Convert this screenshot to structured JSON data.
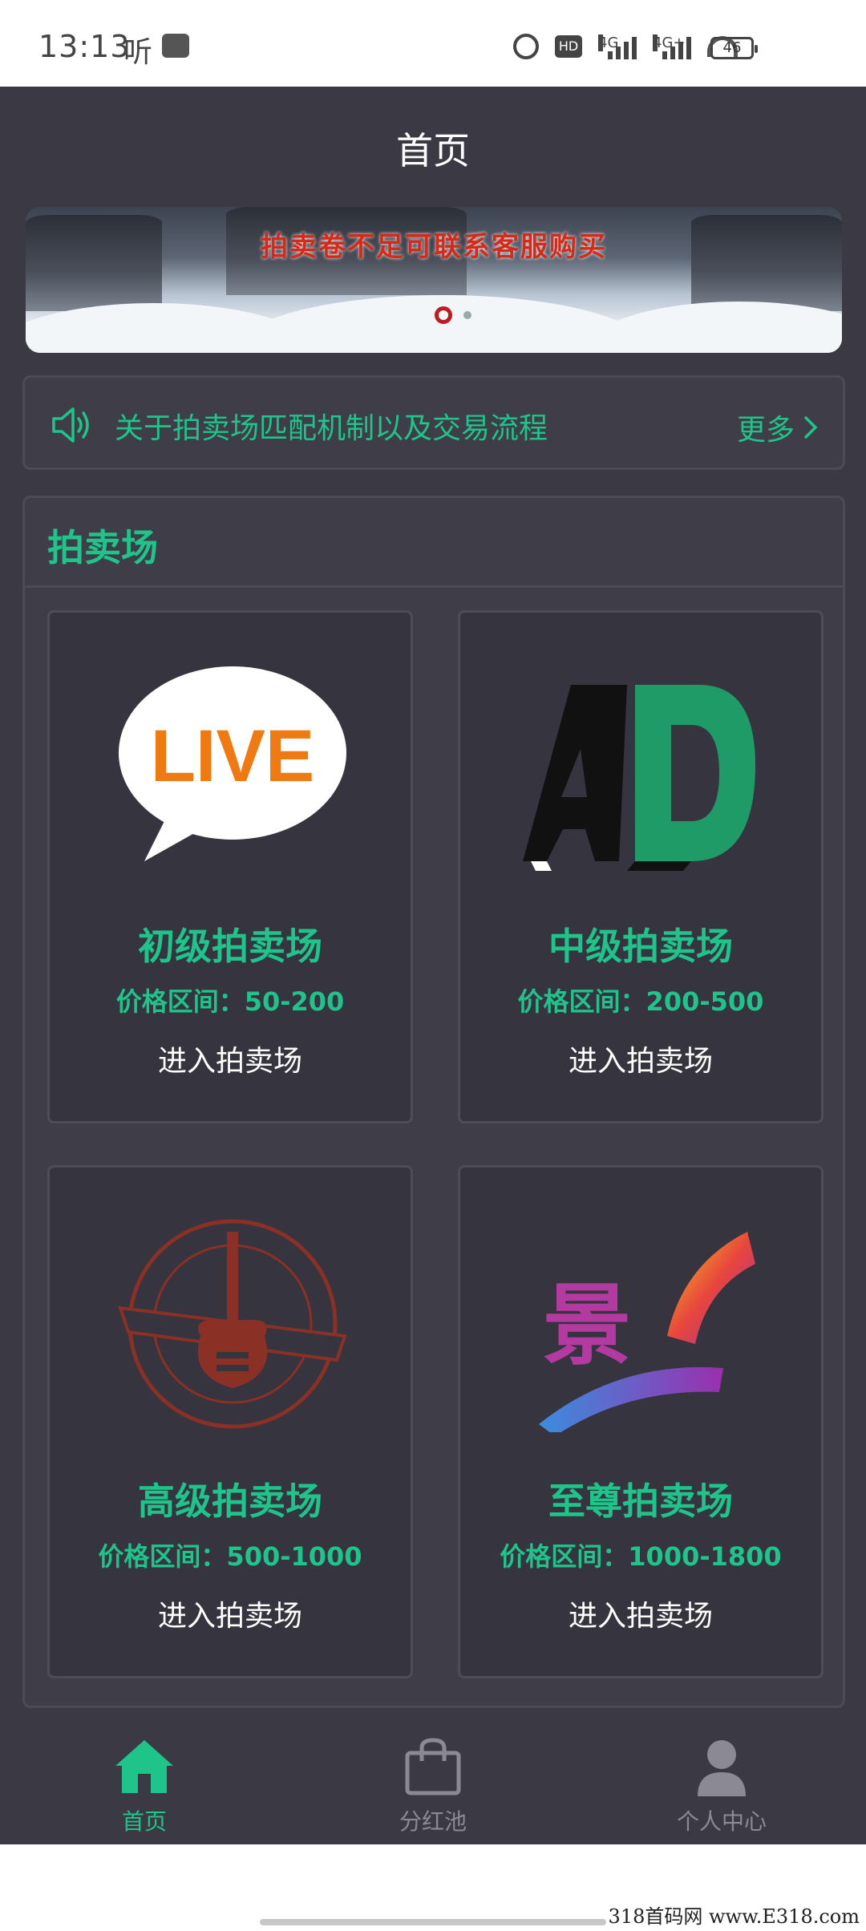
{
  "status_bar": {
    "time": "13:13",
    "listen_label": "听",
    "hd_label": "HD",
    "signal1_label": "4G",
    "signal2_label": "4G+",
    "battery": "46"
  },
  "header": {
    "title": "首页"
  },
  "banner": {
    "text": "拍卖卷不足可联系客服购买",
    "slides": 2,
    "active_slide": 1
  },
  "notice": {
    "text": "关于拍卖场匹配机制以及交易流程",
    "more_label": "更多"
  },
  "section": {
    "title": "拍卖场",
    "cards": [
      {
        "title": "初级拍卖场",
        "price": "价格区间：50-200",
        "enter": "进入拍卖场",
        "logo": "live-logo"
      },
      {
        "title": "中级拍卖场",
        "price": "价格区间：200-500",
        "enter": "进入拍卖场",
        "logo": "ad-logo"
      },
      {
        "title": "高级拍卖场",
        "price": "价格区间：500-1000",
        "enter": "进入拍卖场",
        "logo": "music-studio-logo"
      },
      {
        "title": "至尊拍卖场",
        "price": "价格区间：1000-1800",
        "enter": "进入拍卖场",
        "logo": "film-logo"
      }
    ]
  },
  "bottom_nav": {
    "items": [
      {
        "label": "首页",
        "icon": "home-icon",
        "active": true
      },
      {
        "label": "分红池",
        "icon": "bag-icon",
        "active": false
      },
      {
        "label": "个人中心",
        "icon": "person-icon",
        "active": false
      }
    ]
  },
  "watermark": "318首码网 www.E318.com",
  "colors": {
    "accent": "#1ec48a",
    "background": "#3b3a44",
    "card": "#36343f",
    "banner_text": "#d42a1a"
  }
}
